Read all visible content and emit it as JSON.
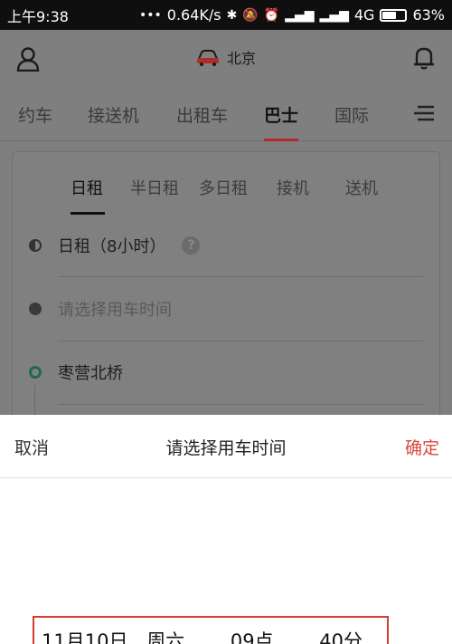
{
  "status": {
    "time": "上午9:38",
    "speed": "0.64K/s",
    "network": "4G",
    "battery": "63%",
    "battery_level": 0.63
  },
  "header": {
    "city": "北京"
  },
  "tabs": [
    {
      "label": "约车"
    },
    {
      "label": "接送机"
    },
    {
      "label": "出租车"
    },
    {
      "label": "巴士"
    },
    {
      "label": "国际"
    }
  ],
  "active_tab": "巴士",
  "card": {
    "subtabs": [
      {
        "label": "日租"
      },
      {
        "label": "半日租"
      },
      {
        "label": "多日租"
      },
      {
        "label": "接机"
      },
      {
        "label": "送机"
      }
    ],
    "rental_type": "日租（8小时）",
    "time_placeholder": "请选择用车时间",
    "start_location": "枣营北桥"
  },
  "sheet": {
    "cancel_label": "取消",
    "title": "请选择用车时间",
    "confirm_label": "确定",
    "picker": {
      "date": "11月10日",
      "weekday": "周六",
      "hour": "09点",
      "minute": "40分"
    }
  },
  "colors": {
    "accent_red": "#d64a3a",
    "tab_underline": "#b22a2a",
    "location_dot": "#1d6b4c"
  }
}
